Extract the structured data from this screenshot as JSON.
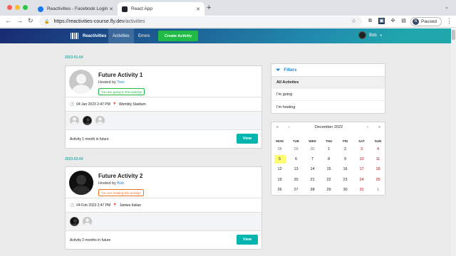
{
  "browser": {
    "tabs": [
      {
        "label": "Reactivities - Facebook Login"
      },
      {
        "label": "React App"
      }
    ],
    "url_host": "https://reactivities-course.fly.dev",
    "url_path": "/activities",
    "profile_initial": "N",
    "profile_label": "Paused"
  },
  "navbar": {
    "brand": "Reactivities",
    "items": [
      {
        "label": "Activities"
      },
      {
        "label": "Errors"
      }
    ],
    "create_label": "Create Activity",
    "user_name": "Bob"
  },
  "groups": [
    {
      "date": "2023-01-04",
      "activity": {
        "title": "Future Activity 1",
        "hosted_prefix": "Hosted by ",
        "host": "Tom",
        "label": "You are going to this activity!",
        "label_kind": "going",
        "datetime": "04 Jan 2023 2:47 PM",
        "venue": "Wembly Stadium",
        "description": "Activity 1 month in future",
        "view_label": "View"
      }
    },
    {
      "date": "2023-02-04",
      "activity": {
        "title": "Future Activity 2",
        "hosted_prefix": "Hosted by ",
        "host": "Bob",
        "label": "You are hosting this activity!",
        "label_kind": "hosting",
        "datetime": "04 Feb 2023 2:47 PM",
        "venue": "Jamies Italian",
        "description": "Activity 2 months in future",
        "view_label": "View"
      }
    }
  ],
  "filters": {
    "title": "Filters",
    "items": [
      {
        "label": "All Activites",
        "active": true
      },
      {
        "label": "I'm going",
        "active": false
      },
      {
        "label": "I'm hosting",
        "active": false
      }
    ]
  },
  "calendar": {
    "month": "December 2022",
    "nav": [
      "«",
      "‹",
      "›",
      "»"
    ],
    "weekdays": [
      "MON",
      "TUE",
      "WED",
      "THU",
      "FRI",
      "SAT",
      "SUN"
    ],
    "weeks": [
      [
        "28",
        "29",
        "30",
        "1",
        "2",
        "3",
        "4"
      ],
      [
        "5",
        "6",
        "7",
        "8",
        "9",
        "10",
        "11"
      ],
      [
        "12",
        "13",
        "14",
        "15",
        "16",
        "17",
        "18"
      ],
      [
        "19",
        "20",
        "21",
        "22",
        "23",
        "24",
        "25"
      ],
      [
        "26",
        "27",
        "28",
        "29",
        "30",
        "31",
        "1"
      ]
    ],
    "selected": "5"
  }
}
